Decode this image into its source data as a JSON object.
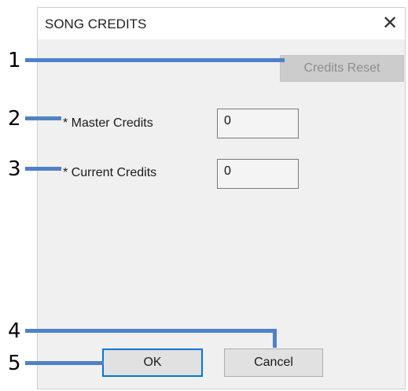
{
  "dialog": {
    "title": "SONG CREDITS",
    "close_glyph": "✕"
  },
  "credits_reset_label": "Credits Reset",
  "fields": [
    {
      "label": "* Master Credits",
      "value": "0"
    },
    {
      "label": "* Current Credits",
      "value": "0"
    }
  ],
  "buttons": {
    "ok_label": "OK",
    "cancel_label": "Cancel"
  },
  "callouts": [
    "1",
    "2",
    "3",
    "4",
    "5"
  ],
  "colors": {
    "callout_line": "#4f81c7",
    "focus_border": "#0078d7",
    "dialog_bg": "#f0f0f0"
  }
}
